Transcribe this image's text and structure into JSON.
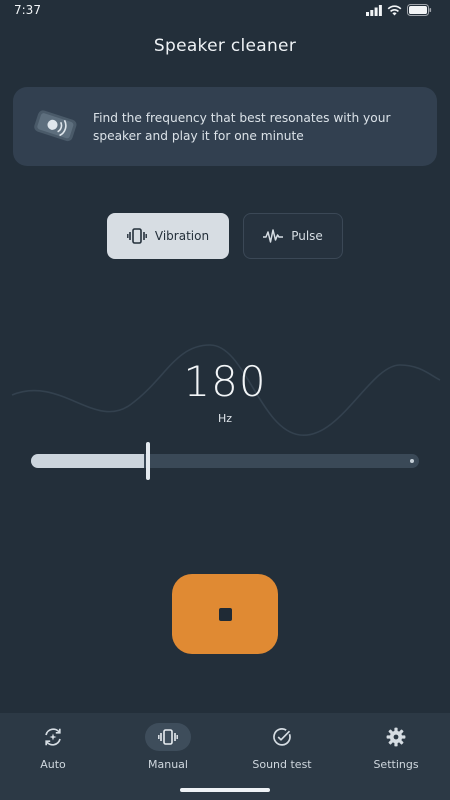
{
  "status_bar": {
    "time": "7:37"
  },
  "header": {
    "title": "Speaker cleaner"
  },
  "info_card": {
    "text": "Find the frequency that best resonates with your speaker and play it for one minute"
  },
  "modes": [
    {
      "label": "Vibration",
      "icon": "vibration-icon",
      "selected": true
    },
    {
      "label": "Pulse",
      "icon": "pulse-wave-icon",
      "selected": false
    }
  ],
  "frequency": {
    "value": "180",
    "unit": "Hz"
  },
  "slider": {
    "level": 0.29
  },
  "player": {
    "state": "playing",
    "icon": "stop-icon"
  },
  "nav": [
    {
      "label": "Auto",
      "icon": "auto-refresh-icon",
      "active": false
    },
    {
      "label": "Manual",
      "icon": "vibration-icon",
      "active": true
    },
    {
      "label": "Sound test",
      "icon": "check-circle-icon",
      "active": false
    },
    {
      "label": "Settings",
      "icon": "gear-icon",
      "active": false
    }
  ],
  "colors": {
    "background": "#232f3a",
    "accent": "#e08a33",
    "card": "#324050",
    "nav": "#2c3945"
  }
}
